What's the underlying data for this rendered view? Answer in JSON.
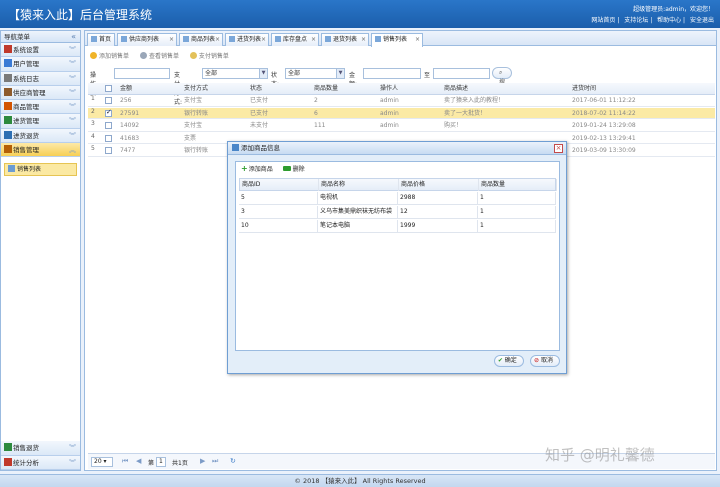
{
  "header": {
    "title": "【猿来入此】后台管理系统",
    "user": "超级管理员:admin，欢迎您！",
    "links": [
      "网站首页",
      "支持论坛",
      "帮助中心",
      "安全退出"
    ]
  },
  "sidebar": {
    "title": "导航菜单",
    "items": [
      {
        "label": "系统设置",
        "icon_color": "#c0392b"
      },
      {
        "label": "用户管理",
        "icon_color": "#3a7bd5"
      },
      {
        "label": "系统日志",
        "icon_color": "#7a7a7a"
      },
      {
        "label": "供应商管理",
        "icon_color": "#8e5b2c"
      },
      {
        "label": "商品管理",
        "icon_color": "#d35400"
      },
      {
        "label": "进货管理",
        "icon_color": "#2d8a3e"
      },
      {
        "label": "进货退货",
        "icon_color": "#2d6fb2"
      },
      {
        "label": "销售管理",
        "icon_color": "#b45f06"
      }
    ],
    "submenu": [
      "销售列表"
    ],
    "bottom_items": [
      {
        "label": "销售退货",
        "icon_color": "#2d8a3e"
      },
      {
        "label": "统计分析",
        "icon_color": "#c0392b"
      }
    ]
  },
  "tabs": [
    "首页",
    "供应商列表",
    "商品列表",
    "进货列表",
    "库存盘点",
    "退货列表",
    "销售列表"
  ],
  "toolbar": [
    "添加销售单",
    "查看销售单",
    "支付销售单"
  ],
  "filter": {
    "operator_label": "操作员:",
    "pay_label": "支付方式:",
    "pay_value": "全部",
    "status_label": "状态:",
    "status_value": "全部",
    "amount_label": "金额:",
    "to_label": "至",
    "search_label": "搜索"
  },
  "table": {
    "columns": [
      "金额",
      "支付方式",
      "状态",
      "商品数量",
      "操作人",
      "商品描述",
      "进货时间"
    ],
    "rows": [
      {
        "num": "1",
        "amount": "256",
        "pay": "支付宝",
        "status": "已支付",
        "qty": "2",
        "op": "admin",
        "desc": "卖了猿来入此的教程！",
        "time": "2017-06-01 11:12:22",
        "checked": false
      },
      {
        "num": "2",
        "amount": "27591",
        "pay": "银行转账",
        "status": "已支付",
        "qty": "6",
        "op": "admin",
        "desc": "卖了一大批货！",
        "time": "2018-07-02 11:14:22",
        "checked": true
      },
      {
        "num": "3",
        "amount": "14092",
        "pay": "支付宝",
        "status": "未支付",
        "qty": "111",
        "op": "admin",
        "desc": "购买！",
        "time": "2019-01-24 13:29:08",
        "checked": false
      },
      {
        "num": "4",
        "amount": "41683",
        "pay": "支票",
        "status": "",
        "qty": "",
        "op": "",
        "desc": "",
        "time": "2019-02-13 13:29:41",
        "checked": false
      },
      {
        "num": "5",
        "amount": "7477",
        "pay": "银行转账",
        "status": "",
        "qty": "",
        "op": "",
        "desc": "",
        "time": "2019-03-09 13:30:09",
        "checked": false
      }
    ]
  },
  "pager": {
    "page_size": "20",
    "page_prefix": "第",
    "page": "1",
    "total": "共1页"
  },
  "dialog": {
    "title": "添加商品信息",
    "add_label": "添加商品",
    "delete_label": "删除",
    "columns": [
      "商品ID",
      "商品名称",
      "商品价格",
      "商品数量"
    ],
    "rows": [
      {
        "id": "5",
        "name": "电视机",
        "price": "2988",
        "qty": "1"
      },
      {
        "id": "3",
        "name": "义乌市集美鼎织袜无纺布袋",
        "price": "12",
        "qty": "1"
      },
      {
        "id": "10",
        "name": "笔记本电脑",
        "price": "1999",
        "qty": "1"
      }
    ],
    "ok_label": "确定",
    "cancel_label": "取消"
  },
  "footer": "© 2018 【猿来入此】 All Rights Reserved",
  "watermark": "知乎 @明礼馨德"
}
